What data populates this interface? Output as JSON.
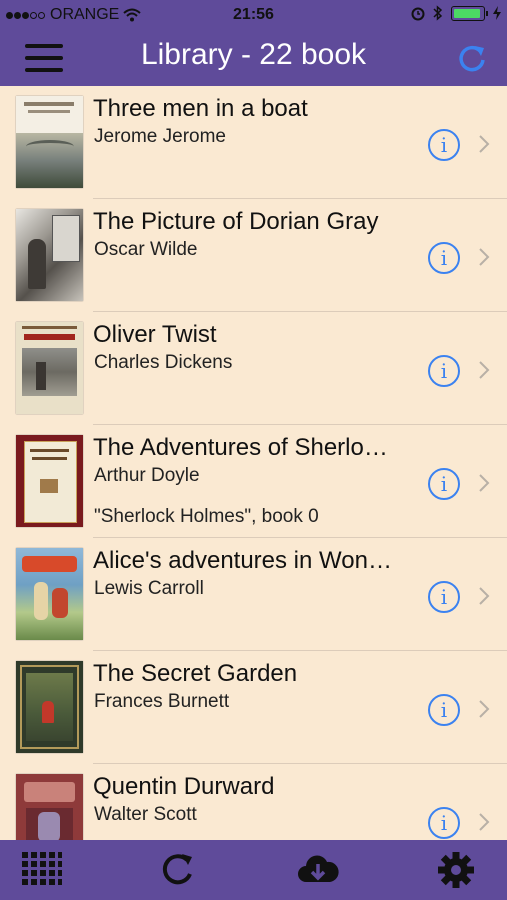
{
  "status": {
    "carrier": "ORANGE",
    "time": "21:56"
  },
  "nav": {
    "title": "Library - 22 book"
  },
  "books": [
    {
      "title": "Three men in a boat",
      "author": "Jerome Jerome",
      "series": ""
    },
    {
      "title": "The Picture of Dorian Gray",
      "author": "Oscar Wilde",
      "series": ""
    },
    {
      "title": "Oliver Twist",
      "author": "Charles Dickens",
      "series": ""
    },
    {
      "title": "The Adventures of Sherlo…",
      "author": "Arthur Doyle",
      "series": "\"Sherlock Holmes\", book 0"
    },
    {
      "title": "Alice's adventures in Won…",
      "author": "Lewis Carroll",
      "series": ""
    },
    {
      "title": "The Secret Garden",
      "author": "Frances Burnett",
      "series": ""
    },
    {
      "title": "Quentin Durward",
      "author": "Walter Scott",
      "series": ""
    }
  ],
  "colors": {
    "bar": "#5f4b9a",
    "background": "#fae9d2",
    "accent": "#3b82f0"
  },
  "icons": {
    "menu": "hamburger-icon",
    "refresh": "refresh-icon",
    "info": "info-icon",
    "chevron": "chevron-right-icon",
    "tabs": [
      "grid-icon",
      "sync-icon",
      "cloud-download-icon",
      "gear-icon"
    ]
  }
}
